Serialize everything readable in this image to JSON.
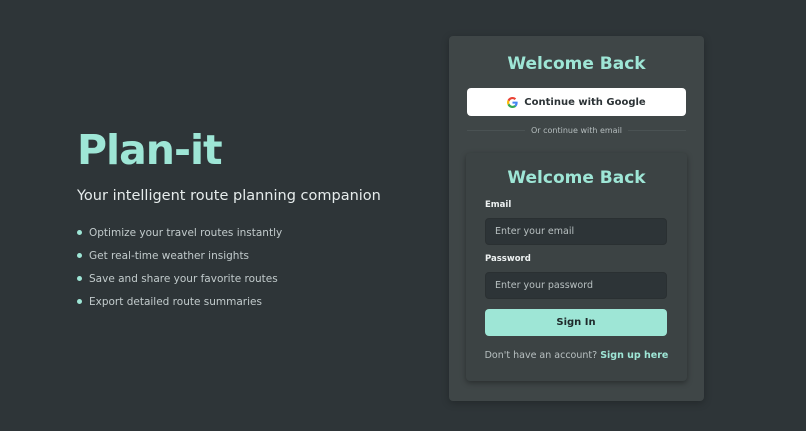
{
  "hero": {
    "brand": "Plan-it",
    "tagline": "Your intelligent route planning companion",
    "features": [
      "Optimize your travel routes instantly",
      "Get real-time weather insights",
      "Save and share your favorite routes",
      "Export detailed route summaries"
    ]
  },
  "auth": {
    "title": "Welcome Back",
    "google_label": "Continue with Google",
    "divider_text": "Or continue with email"
  },
  "form": {
    "title": "Welcome Back",
    "email_label": "Email",
    "email_placeholder": "Enter your email",
    "email_value": "",
    "password_label": "Password",
    "password_placeholder": "Enter your password",
    "password_value": "",
    "signin_label": "Sign In",
    "signup_prompt": "Don't have an account?",
    "signup_link": "Sign up here"
  },
  "colors": {
    "background": "#2e3538",
    "accent": "#9ee6d6",
    "card": "#3f4647"
  },
  "icons": {
    "google": "google-icon",
    "bullet": "bullet-dot-icon"
  }
}
